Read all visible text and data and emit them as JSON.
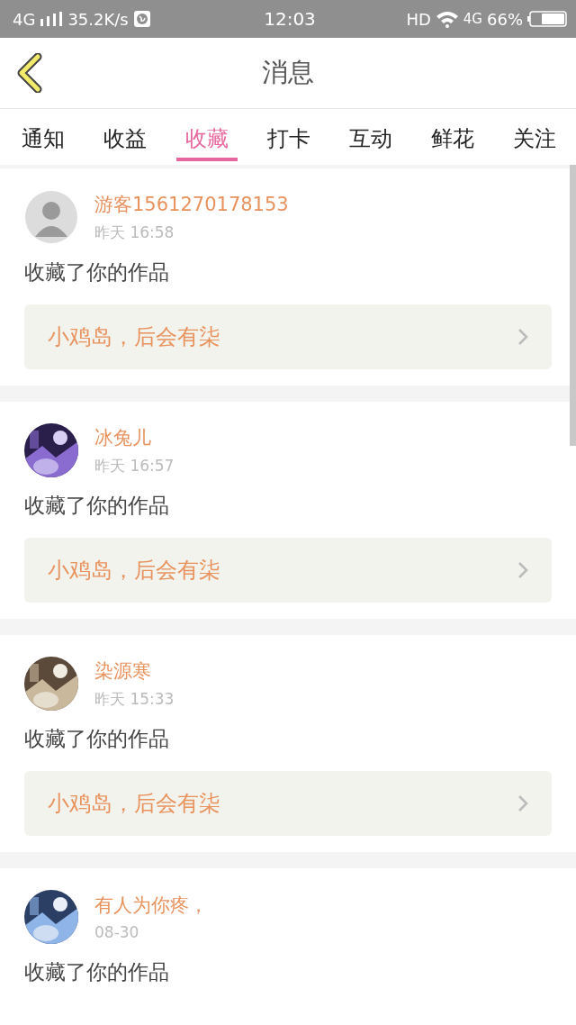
{
  "status_bar": {
    "network": "4G",
    "speed": "35.2K/s",
    "time": "12:03",
    "hd": "HD",
    "data_network": "4G",
    "battery": "66%"
  },
  "header": {
    "title": "消息"
  },
  "tabs": [
    {
      "label": "通知",
      "selected": false
    },
    {
      "label": "收益",
      "selected": false
    },
    {
      "label": "收藏",
      "selected": true
    },
    {
      "label": "打卡",
      "selected": false
    },
    {
      "label": "互动",
      "selected": false
    },
    {
      "label": "鲜花",
      "selected": false
    },
    {
      "label": "关注",
      "selected": false
    }
  ],
  "messages": [
    {
      "avatar": {
        "kind": "icon"
      },
      "name": "游客1561270178153",
      "time": "昨天 16:58",
      "text": "收藏了你的作品",
      "work": "小鸡岛，后会有柒"
    },
    {
      "name": "冰兔儿",
      "time": "昨天 16:57",
      "text": "收藏了你的作品",
      "work": "小鸡岛，后会有柒"
    },
    {
      "name": "染源寒",
      "time": "昨天 15:33",
      "text": "收藏了你的作品",
      "work": "小鸡岛，后会有柒"
    },
    {
      "name": "有人为你疼，",
      "time": "08-30",
      "text": "收藏了你的作品"
    }
  ]
}
